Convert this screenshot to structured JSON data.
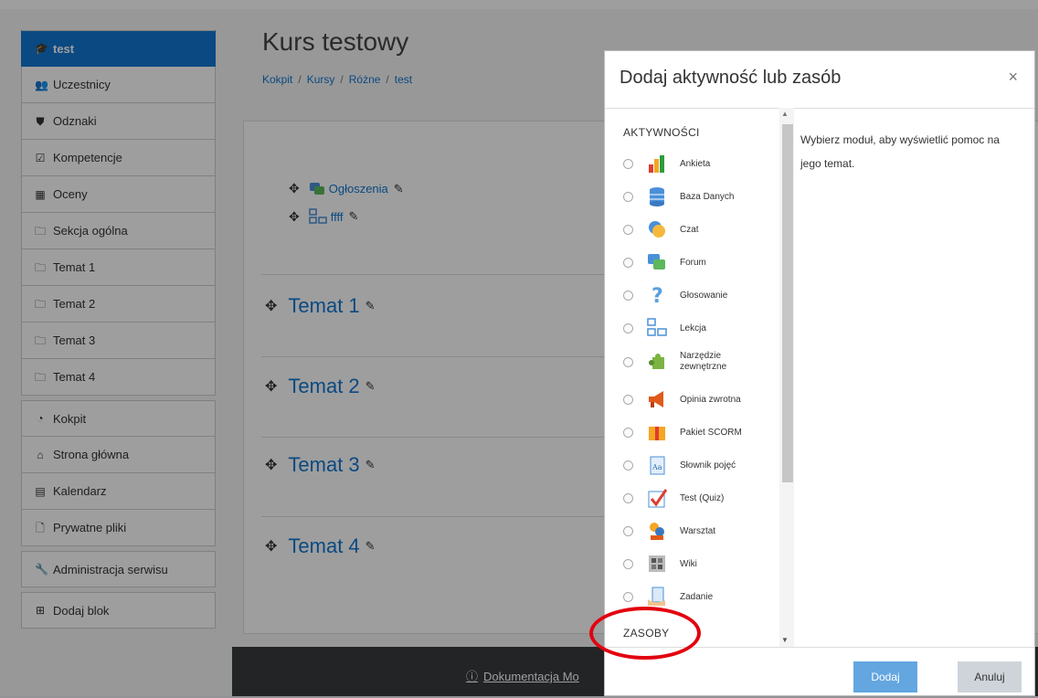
{
  "sidebar": {
    "groups": [
      [
        {
          "label": "test",
          "icon": "graduation-cap-icon",
          "active": true
        },
        {
          "label": "Uczestnicy",
          "icon": "users-icon"
        },
        {
          "label": "Odznaki",
          "icon": "shield-icon"
        },
        {
          "label": "Kompetencje",
          "icon": "checkbox-icon"
        },
        {
          "label": "Oceny",
          "icon": "table-icon"
        },
        {
          "label": "Sekcja ogólna",
          "icon": "folder-icon"
        },
        {
          "label": "Temat 1",
          "icon": "folder-icon"
        },
        {
          "label": "Temat 2",
          "icon": "folder-icon"
        },
        {
          "label": "Temat 3",
          "icon": "folder-icon"
        },
        {
          "label": "Temat 4",
          "icon": "folder-icon"
        }
      ],
      [
        {
          "label": "Kokpit",
          "icon": "dashboard-icon"
        },
        {
          "label": "Strona główna",
          "icon": "home-icon"
        },
        {
          "label": "Kalendarz",
          "icon": "calendar-icon"
        },
        {
          "label": "Prywatne pliki",
          "icon": "file-icon"
        }
      ],
      [
        {
          "label": "Administracja serwisu",
          "icon": "wrench-icon"
        }
      ],
      [
        {
          "label": "Dodaj blok",
          "icon": "plus-square-icon"
        }
      ]
    ]
  },
  "course": {
    "title": "Kurs testowy",
    "breadcrumb": [
      "Kokpit",
      "Kursy",
      "Różne",
      "test"
    ],
    "activities": [
      "Ogłoszenia",
      "ffff"
    ],
    "sections": [
      "Temat 1",
      "Temat 2",
      "Temat 3",
      "Temat 4"
    ]
  },
  "footer": {
    "link": "Dokumentacja Mo"
  },
  "modal": {
    "title": "Dodaj aktywność lub zasób",
    "close": "×",
    "activities_label": "AKTYWNOŚCI",
    "resources_label": "ZASOBY",
    "modules": [
      {
        "label": "Ankieta",
        "icon": "bar-chart-icon"
      },
      {
        "label": "Baza Danych",
        "icon": "database-icon"
      },
      {
        "label": "Czat",
        "icon": "chat-icon"
      },
      {
        "label": "Forum",
        "icon": "forum-icon"
      },
      {
        "label": "Głosowanie",
        "icon": "question-mark-icon"
      },
      {
        "label": "Lekcja",
        "icon": "lesson-icon"
      },
      {
        "label": "Narzędzie zewnętrzne",
        "icon": "puzzle-icon"
      },
      {
        "label": "Opinia zwrotna",
        "icon": "megaphone-icon"
      },
      {
        "label": "Pakiet SCORM",
        "icon": "package-icon"
      },
      {
        "label": "Słownik pojęć",
        "icon": "glossary-icon"
      },
      {
        "label": "Test (Quiz)",
        "icon": "quiz-check-icon"
      },
      {
        "label": "Warsztat",
        "icon": "workshop-icon"
      },
      {
        "label": "Wiki",
        "icon": "wiki-icon"
      },
      {
        "label": "Zadanie",
        "icon": "assignment-icon"
      }
    ],
    "help": "Wybierz moduł, aby wyświetlić pomoc na jego temat.",
    "add_button": "Dodaj",
    "cancel_button": "Anuluj"
  },
  "colors": {
    "accent": "#1177d1",
    "annotation": "#e3000f",
    "footer": "#373a3c"
  }
}
